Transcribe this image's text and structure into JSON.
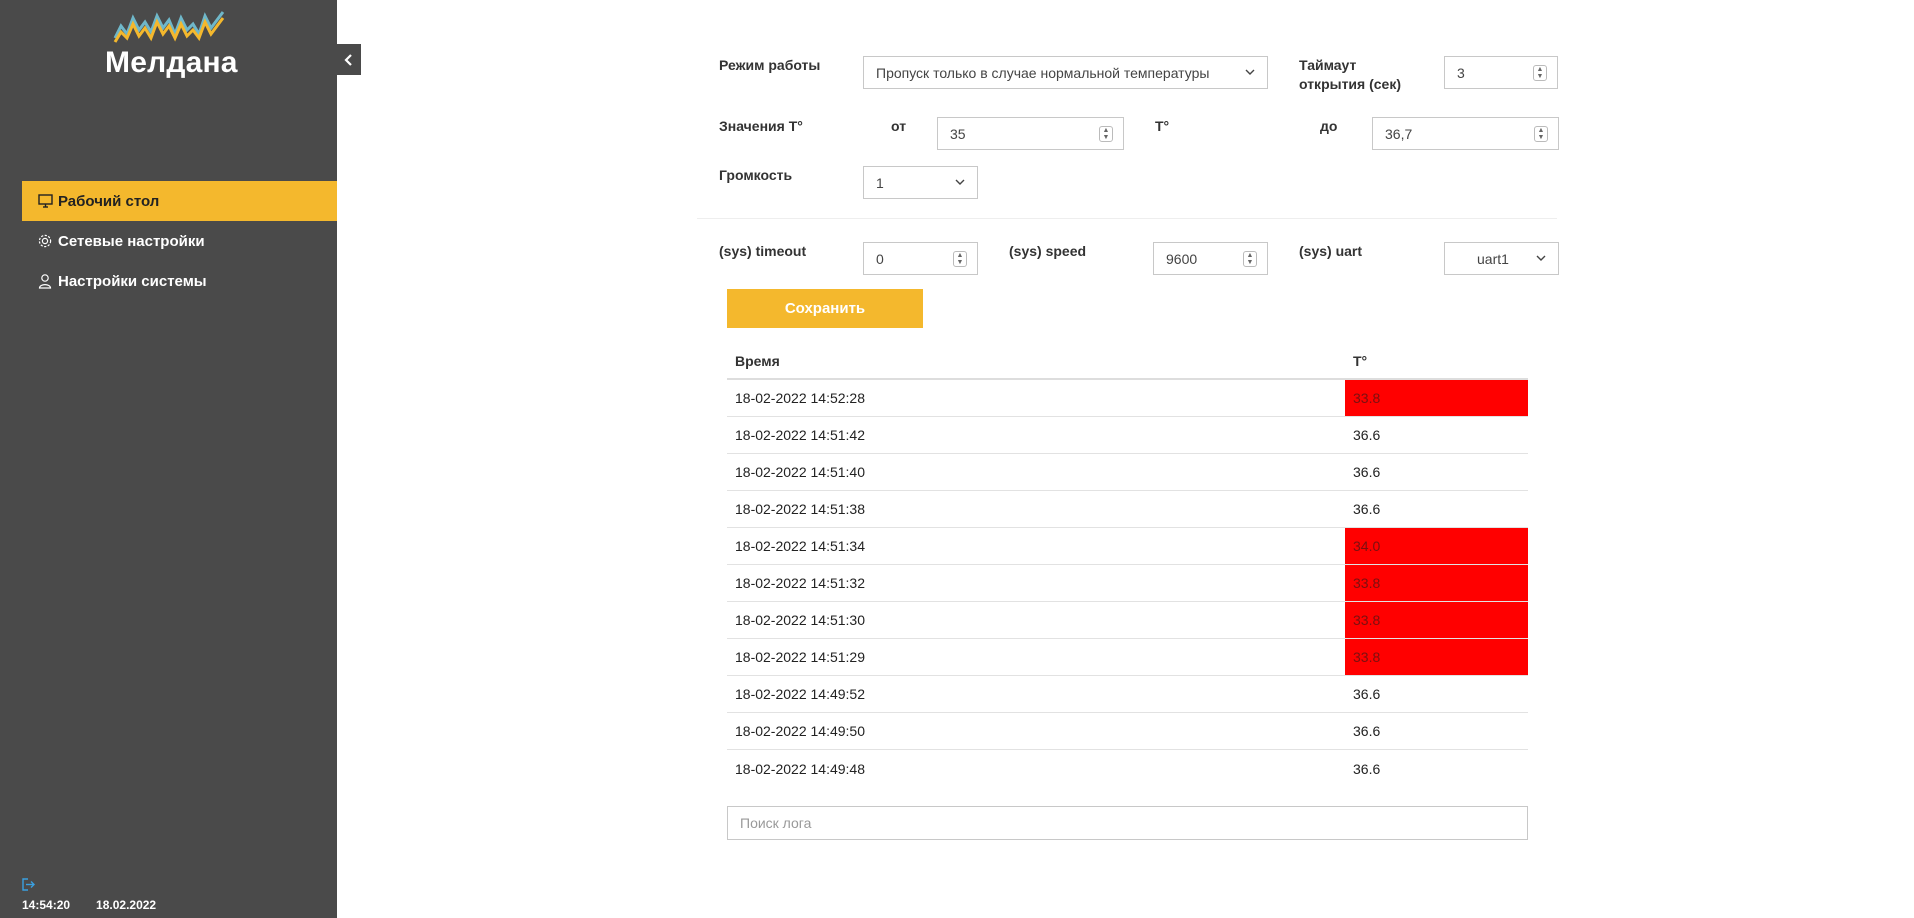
{
  "sidebar": {
    "logo_text": "Мелдана",
    "items": [
      {
        "label": "Рабочий стол",
        "icon": "monitor-icon",
        "active": true
      },
      {
        "label": "Сетевые настройки",
        "icon": "gear-icon",
        "active": false
      },
      {
        "label": "Настройки системы",
        "icon": "user-icon",
        "active": false
      }
    ],
    "footer": {
      "time": "14:54:20",
      "date": "18.02.2022"
    }
  },
  "form": {
    "mode_label": "Режим работы",
    "mode_value": "Пропуск только в случае нормальной температуры",
    "timeout_label_line1": "Таймаут",
    "timeout_label_line2": "открытия (сек)",
    "timeout_value": "3",
    "temp_label": "Значения T°",
    "from_label": "от",
    "from_value": "35",
    "temp_unit": "T°",
    "to_label": "до",
    "to_value": "36,7",
    "volume_label": "Громкость",
    "volume_value": "1",
    "sys_timeout_label": "(sys) timeout",
    "sys_timeout_value": "0",
    "sys_speed_label": "(sys) speed",
    "sys_speed_value": "9600",
    "sys_uart_label": "(sys) uart",
    "sys_uart_value": "uart1",
    "save_label": "Сохранить"
  },
  "log": {
    "headers": {
      "time": "Время",
      "temp": "T°"
    },
    "rows": [
      {
        "time": "18-02-2022 14:52:28",
        "temp": "33.8",
        "bad": true
      },
      {
        "time": "18-02-2022 14:51:42",
        "temp": "36.6",
        "bad": false
      },
      {
        "time": "18-02-2022 14:51:40",
        "temp": "36.6",
        "bad": false
      },
      {
        "time": "18-02-2022 14:51:38",
        "temp": "36.6",
        "bad": false
      },
      {
        "time": "18-02-2022 14:51:34",
        "temp": "34.0",
        "bad": true
      },
      {
        "time": "18-02-2022 14:51:32",
        "temp": "33.8",
        "bad": true
      },
      {
        "time": "18-02-2022 14:51:30",
        "temp": "33.8",
        "bad": true
      },
      {
        "time": "18-02-2022 14:51:29",
        "temp": "33.8",
        "bad": true
      },
      {
        "time": "18-02-2022 14:49:52",
        "temp": "36.6",
        "bad": false
      },
      {
        "time": "18-02-2022 14:49:50",
        "temp": "36.6",
        "bad": false
      },
      {
        "time": "18-02-2022 14:49:48",
        "temp": "36.6",
        "bad": false
      }
    ],
    "search_placeholder": "Поиск лога"
  },
  "colors": {
    "accent": "#f4b82d",
    "sidebar": "#4a4a4a",
    "alert": "#ff0000"
  }
}
